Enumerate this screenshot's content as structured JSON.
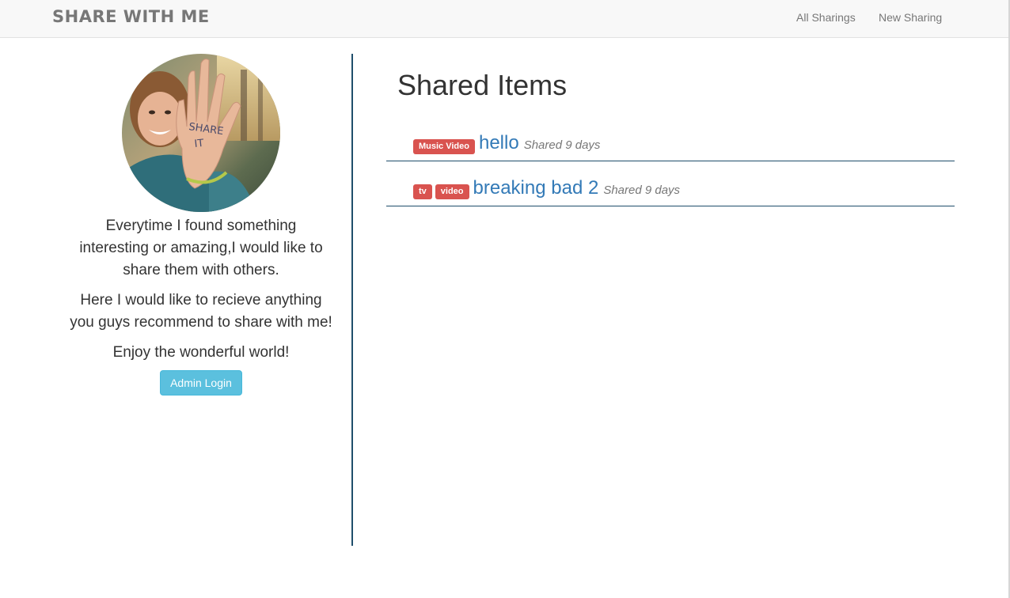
{
  "navbar": {
    "brand": "SHARE WITH ME",
    "links": [
      "All Sharings",
      "New Sharing"
    ]
  },
  "sidebar": {
    "avatar_icon": "profile-photo-hand-share-it",
    "avatar_hand_text_1": "SHARE",
    "avatar_hand_text_2": "IT",
    "bio": [
      "Everytime I found something interesting or amazing,I would like to share them with others.",
      "Here I would like to recieve anything you guys recommend to share with me!",
      "Enjoy the wonderful world!"
    ],
    "admin_button": "Admin Login"
  },
  "main": {
    "title": "Shared Items",
    "items": [
      {
        "labels": [
          "Music Video"
        ],
        "title": "hello",
        "shared": "Shared 9 days"
      },
      {
        "labels": [
          "tv",
          "video"
        ],
        "title": "breaking bad 2",
        "shared": "Shared 9 days"
      }
    ]
  },
  "colors": {
    "navbar_bg": "#f8f8f8",
    "link": "#337ab7",
    "label": "#d9534f",
    "button": "#5bc0de",
    "divider": "#1f4e6b"
  }
}
